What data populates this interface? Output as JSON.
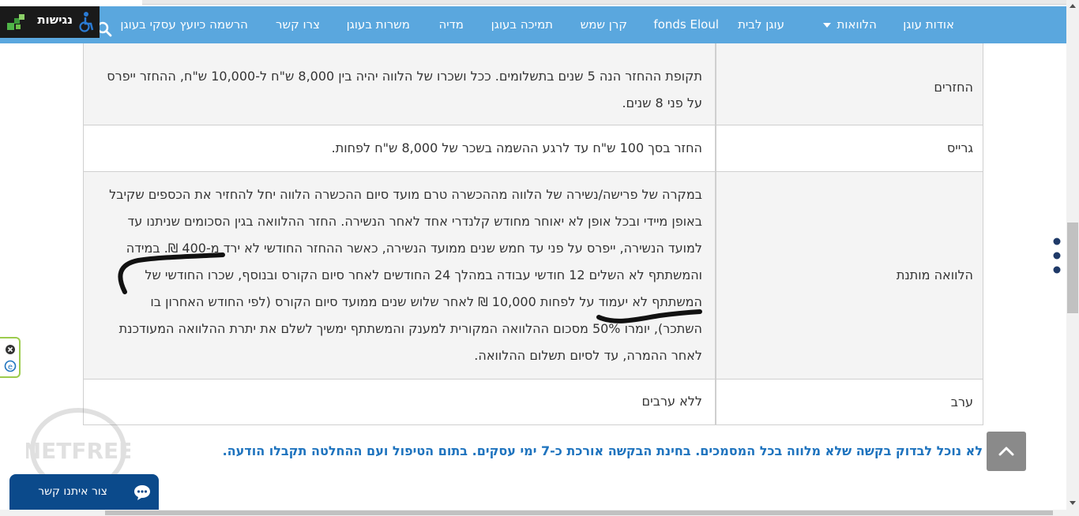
{
  "nav": {
    "items": [
      {
        "label": "אודות עוגן"
      },
      {
        "label": "הלוואות",
        "has_dropdown": true
      },
      {
        "label": "עוגן לבית"
      },
      {
        "label": "fonds Eloul"
      },
      {
        "label": "קרן שמש"
      },
      {
        "label": "תמיכה בעוגן"
      },
      {
        "label": "מדיה"
      },
      {
        "label": "משרות בעוגן"
      },
      {
        "label": "צרו קשר"
      },
      {
        "label": "הרשמה כיועץ עסקי בעוגן"
      }
    ]
  },
  "accessibility": {
    "label": "נגישות"
  },
  "table": {
    "rows": [
      {
        "label": "החזרים",
        "value_lines": [
          "תקופת ההחזר הנה 5 שנים בתשלומים. ככל ושכרו של הלווה יהיה בין 8,000 ש\"ח ל-10,000 ש\"ח, ההחזר ייפרס",
          "על פני 8 שנים."
        ]
      },
      {
        "label": "גרייס",
        "value_lines": [
          "החזר בסך 100 ש\"ח עד לרגע ההשמה בשכר של 8,000 ש\"ח לפחות."
        ]
      },
      {
        "label": "הלוואה מותנת",
        "value_lines": [
          "במקרה של פרישה/נשירה של הלווה מההכשרה טרם מועד סיום ההכשרה הלווה יחל להחזיר את הכספים שקיבל",
          "באופן מיידי ובכל אופן לא יאוחר מחודש קלנדרי אחד לאחר הנשירה. החזר ההלוואה בגין הסכומים שניתנו עד",
          "למועד הנשירה, ייפרס על פני עד חמש שנים ממועד הנשירה, כאשר ההחזר החודשי לא ירד מ-400 ₪. במידה",
          "והמשתתף לא השלים 12 חודשי עבודה במהלך 24 החודשים לאחר סיום הקורס ובנוסף, שכרו החודשי של",
          "המשתתף לא יעמוד על לפחות 10,000 ₪ לאחר שלוש שנים ממועד סיום הקורס (לפי החודש האחרון בו",
          "השתכר), יומרו 50% מסכום ההלוואה המקורית למענק והמשתתף ימשיך לשלם את יתרת ההלוואה המעודכנת",
          "לאחר ההמרה, עד לסיום תשלום ההלוואה."
        ]
      },
      {
        "label": "ערב",
        "value_lines": [
          "ללא ערבים"
        ]
      }
    ]
  },
  "footnote": "לא נוכל לבדוק בקשה שלא מלווה בכל המסמכים. בחינת הבקשה אורכת כ-7 ימי עסקים. בתום הטיפול ועם ההחלטה תקבלו הודעה.",
  "contact": {
    "label": "צור איתנו קשר"
  },
  "icons": {
    "search": "search-icon",
    "scroll_top": "chevron-up-icon",
    "chat": "chat-icon",
    "menu": "more-vertical-icon"
  },
  "colors": {
    "nav_bg": "#5aa7de",
    "footnote": "#1e73be",
    "contact_bg": "#0b4a8b"
  }
}
